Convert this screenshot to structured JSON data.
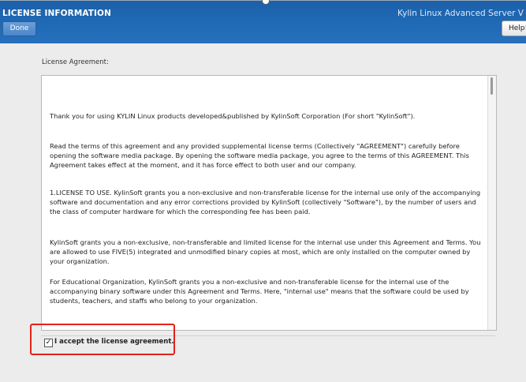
{
  "header": {
    "title": "LICENSE INFORMATION",
    "subtitle": "Kylin Linux Advanced Server V",
    "done_label": "Done",
    "help_label": "Help!"
  },
  "main": {
    "label": "License Agreement:",
    "paragraphs": [
      "Thank you for using KYLIN Linux products developed&published by KylinSoft Corporation (For short \"KylinSoft\").",
      "Read the terms of this agreement and any provided supplemental license terms (Collectively \"AGREEMENT\") carefully before opening the software media package. By opening the software media package, you agree to the terms of this AGREEMENT. This Agreement takes effect at the moment, and it has force effect to both user and our company.",
      "1.LICENSE TO USE. KylinSoft grants you a non-exclusive and non-transferable license for the internal use only of the accompanying software and documentation and any error corrections provided by KylinSoft (collectively \"Software\"), by the number of users and the class of computer hardware for which the corresponding fee has been paid.",
      "KylinSoft grants you a non-exclusive, non-transferable and limited license for the internal use under this Agreement and Terms. You are allowed to use FIVE(5) integrated and unmodified binary copies at most, which are only installed on the computer owned by your organization.",
      "For Educational Organization, KylinSoft grants you a non-exclusive and non-transferable license for the internal use of the accompanying binary software under this Agreement and Terms. Here, \"internal use\" means that the software could be used by students, teachers, and staffs who belong to your organization."
    ],
    "accept_label": "I accept the license agreement.",
    "accept_checked": true,
    "checkmark": "✓"
  },
  "colors": {
    "header_blue": "#1f68b3",
    "highlight_red": "#e2231a"
  }
}
